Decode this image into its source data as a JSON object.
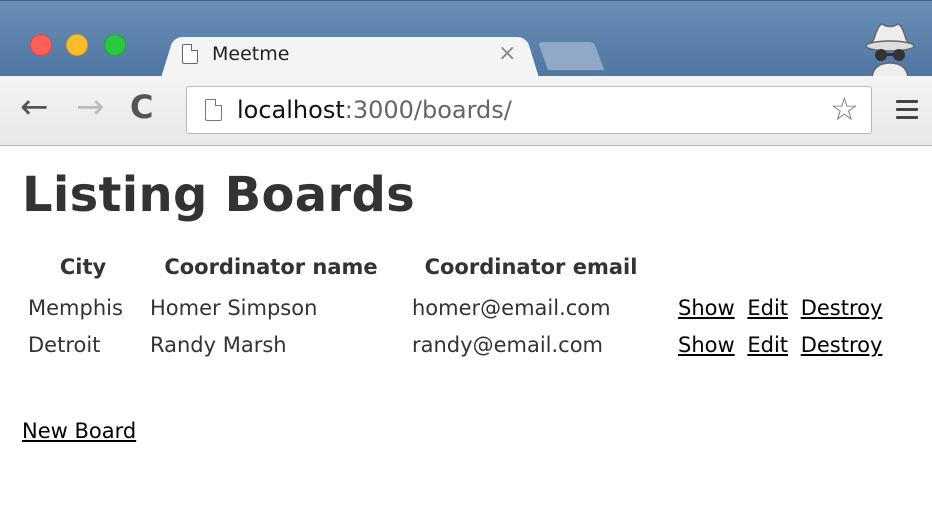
{
  "browser": {
    "tab_title": "Meetme",
    "tab_close": "×",
    "url_host": "localhost",
    "url_rest": ":3000/boards/",
    "icons": [
      "back-arrow-icon",
      "forward-arrow-icon",
      "reload-icon",
      "page-icon",
      "star-icon",
      "menu-icon",
      "incognito-icon"
    ],
    "nav": {
      "back": "←",
      "forward": "→",
      "reload": "C"
    },
    "star": "☆"
  },
  "page": {
    "title": "Listing Boards",
    "table": {
      "headers": [
        "City",
        "Coordinator name",
        "Coordinator email"
      ],
      "rows": [
        {
          "city": "Memphis",
          "name": "Homer Simpson",
          "email": "homer@email.com",
          "show": "Show",
          "edit": "Edit",
          "destroy": "Destroy"
        },
        {
          "city": "Detroit",
          "name": "Randy Marsh",
          "email": "randy@email.com",
          "show": "Show",
          "edit": "Edit",
          "destroy": "Destroy"
        }
      ]
    },
    "new_board": "New Board"
  },
  "colors": {
    "titlebar": "#5b80ab",
    "close_red": "#fc5f57",
    "minimize_yellow": "#fdbb2e",
    "zoom_green": "#2ac840",
    "text": "#333333"
  }
}
